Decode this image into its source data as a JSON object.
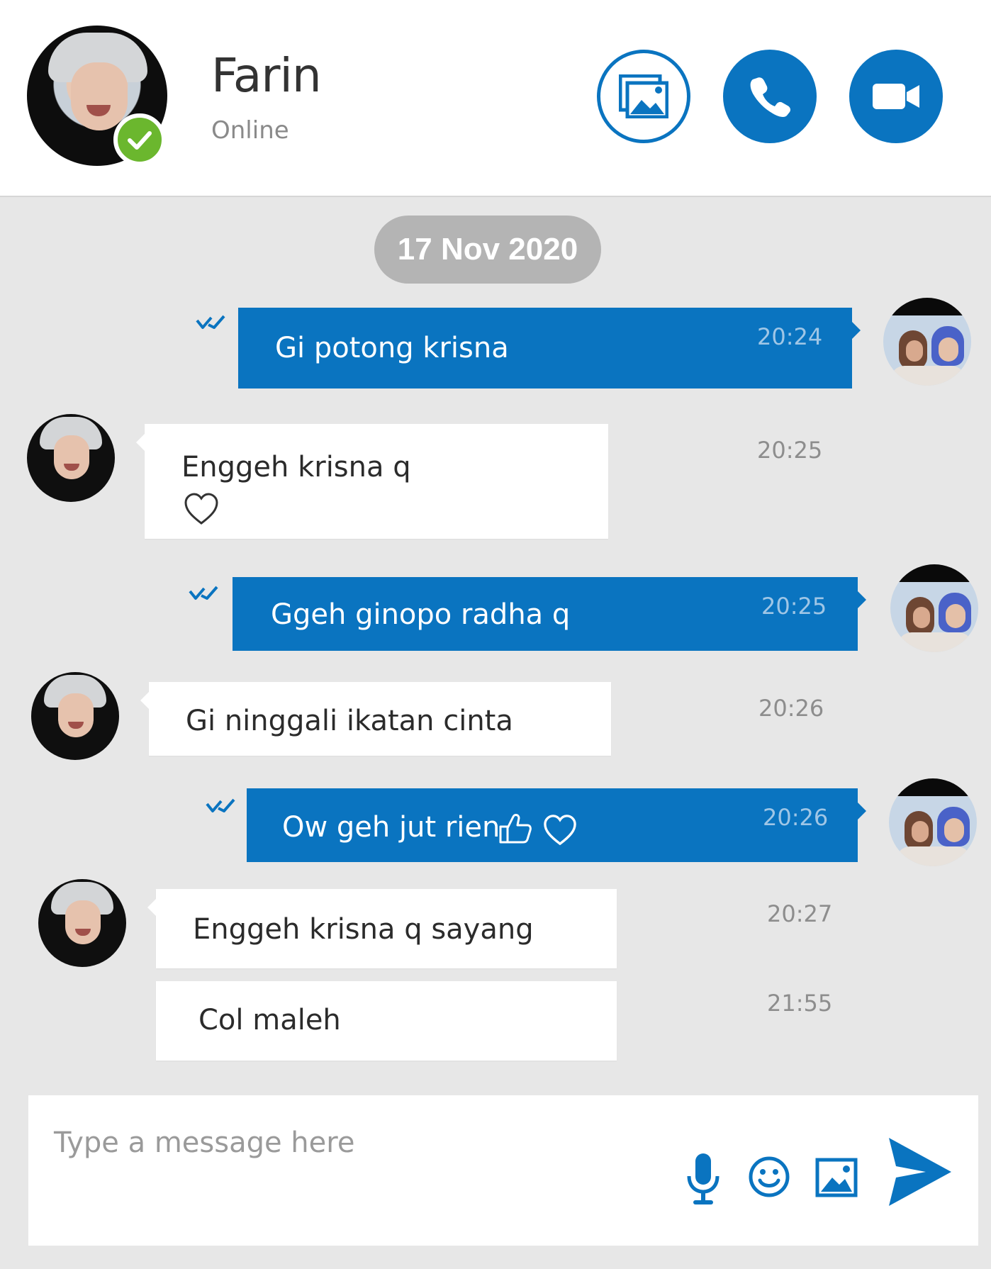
{
  "contact": {
    "name": "Farin",
    "status": "Online"
  },
  "header_buttons": {
    "gallery_icon": "image-gallery-icon",
    "call_icon": "phone-icon",
    "video_icon": "video-camera-icon"
  },
  "date_separator": "17 Nov 2020",
  "messages": [
    {
      "direction": "outgoing",
      "text": "Gi potong krisna",
      "time": "20:24"
    },
    {
      "direction": "incoming",
      "text": "Enggeh krisna q",
      "emoji": "heart-outline",
      "time": "20:25"
    },
    {
      "direction": "outgoing",
      "text": "Ggeh ginopo radha q",
      "time": "20:25"
    },
    {
      "direction": "incoming",
      "text": "Gi ninggali ikatan cinta",
      "time": "20:26"
    },
    {
      "direction": "outgoing",
      "text": "Ow geh jut rien",
      "emoji": "thumbs-up-outline, heart-outline",
      "time": "20:26"
    },
    {
      "direction": "incoming",
      "text": "Enggeh krisna q sayang",
      "time": "20:27"
    },
    {
      "direction": "incoming",
      "text": "Col maleh",
      "time": "21:55"
    }
  ],
  "composer": {
    "placeholder": "Type a message here",
    "icons": [
      "microphone-icon",
      "emoji-icon",
      "image-icon",
      "send-icon"
    ]
  },
  "colors": {
    "accent": "#0a74c0",
    "online": "#6bb72e",
    "background": "#e7e7e7",
    "date_pill": "#b4b4b4"
  }
}
